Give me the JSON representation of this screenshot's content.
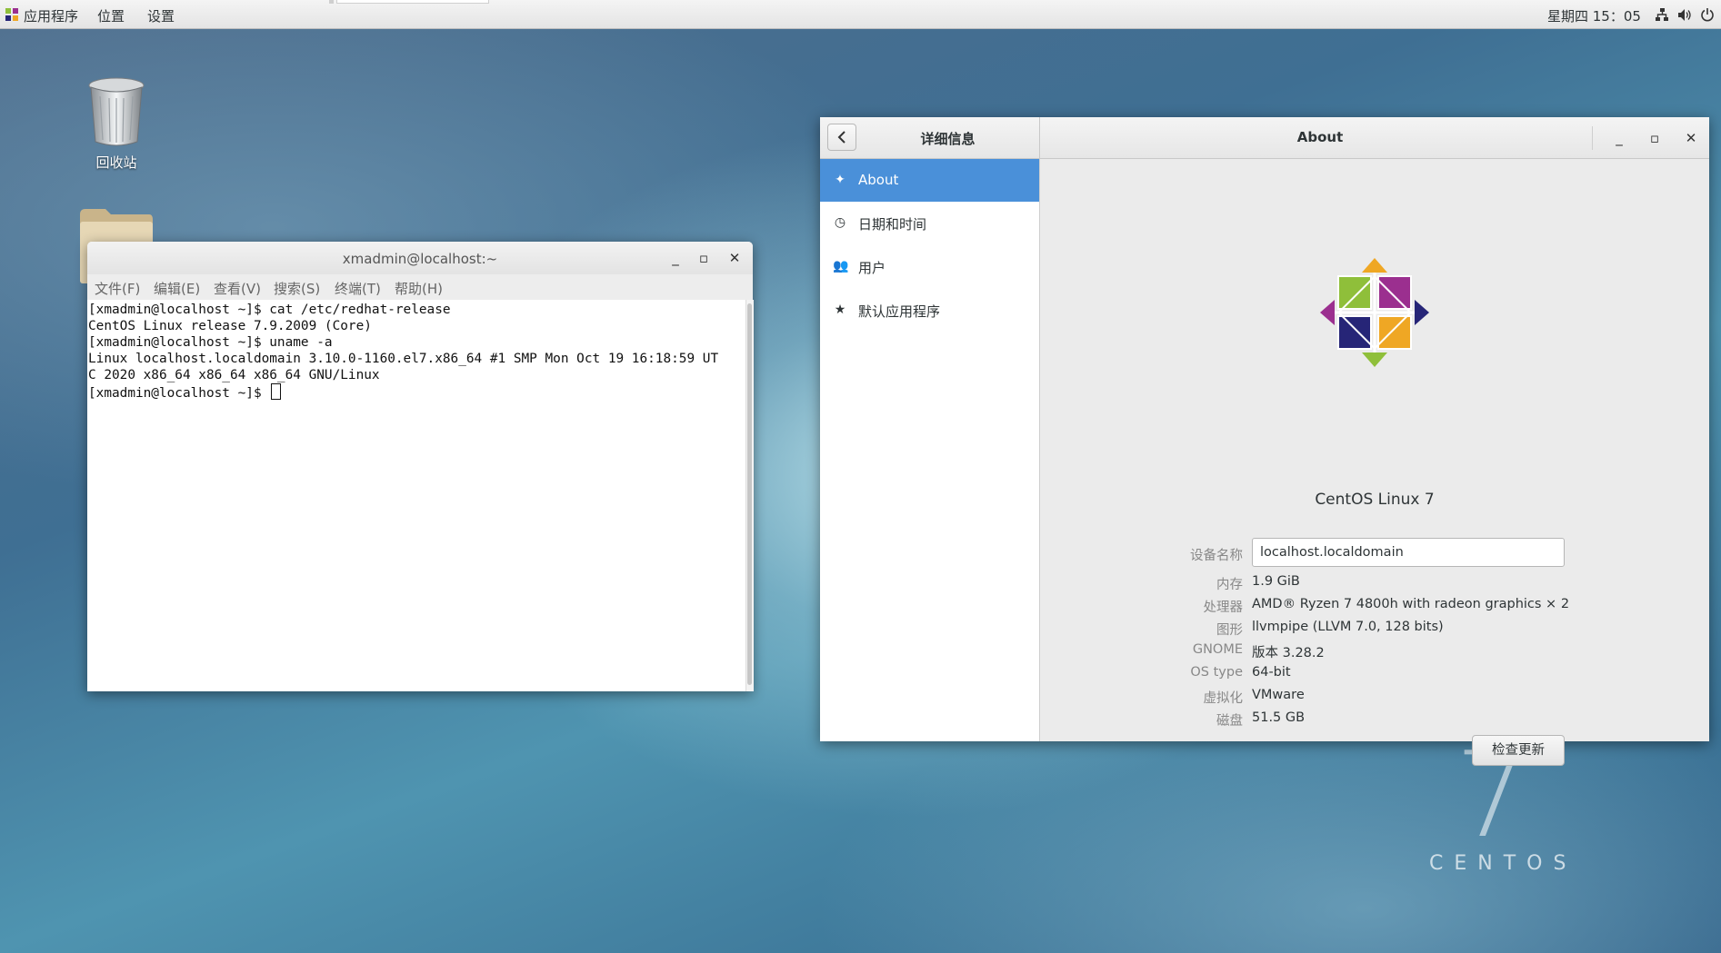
{
  "topbar": {
    "menus": [
      "应用程序",
      "位置",
      "设置"
    ],
    "clock": "星期四 15：05",
    "tray_icons": [
      "network-icon",
      "volume-icon",
      "power-icon"
    ]
  },
  "desktop": {
    "trash_label": "回收站",
    "watermark_number": "7",
    "watermark_text": "CENTOS"
  },
  "terminal": {
    "title": "xmadmin@localhost:~",
    "menus": [
      "文件(F)",
      "编辑(E)",
      "查看(V)",
      "搜索(S)",
      "终端(T)",
      "帮助(H)"
    ],
    "lines": [
      "[xmadmin@localhost ~]$ cat /etc/redhat-release",
      "CentOS Linux release 7.9.2009 (Core)",
      "[xmadmin@localhost ~]$ uname -a",
      "Linux localhost.localdomain 3.10.0-1160.el7.x86_64 #1 SMP Mon Oct 19 16:18:59 UT",
      "C 2020 x86_64 x86_64 x86_64 GNU/Linux",
      "[xmadmin@localhost ~]$ "
    ]
  },
  "settings": {
    "panel_title": "详细信息",
    "page_title": "About",
    "sidebar": [
      {
        "label": "About",
        "icon": "sparkle-icon",
        "active": true
      },
      {
        "label": "日期和时间",
        "icon": "clock-icon",
        "active": false
      },
      {
        "label": "用户",
        "icon": "users-icon",
        "active": false
      },
      {
        "label": "默认应用程序",
        "icon": "star-icon",
        "active": false
      }
    ],
    "os_name": "CentOS Linux 7",
    "device_name_label": "设备名称",
    "device_name_value": "localhost.localdomain",
    "info": [
      {
        "label": "内存",
        "value": "1.9 GiB"
      },
      {
        "label": "处理器",
        "value": "AMD® Ryzen 7 4800h with radeon graphics × 2"
      },
      {
        "label": "图形",
        "value": "llvmpipe (LLVM 7.0, 128 bits)"
      },
      {
        "label": "GNOME",
        "value": "版本 3.28.2"
      },
      {
        "label": "OS type",
        "value": "64-bit"
      },
      {
        "label": "虚拟化",
        "value": "VMware"
      },
      {
        "label": "磁盘",
        "value": "51.5 GB"
      }
    ],
    "update_button": "检查更新"
  },
  "colors": {
    "accent": "#4a90d9",
    "logo_green": "#8fbf3a",
    "logo_purple": "#9b2f8f",
    "logo_orange": "#efa724",
    "logo_blue": "#262577"
  }
}
